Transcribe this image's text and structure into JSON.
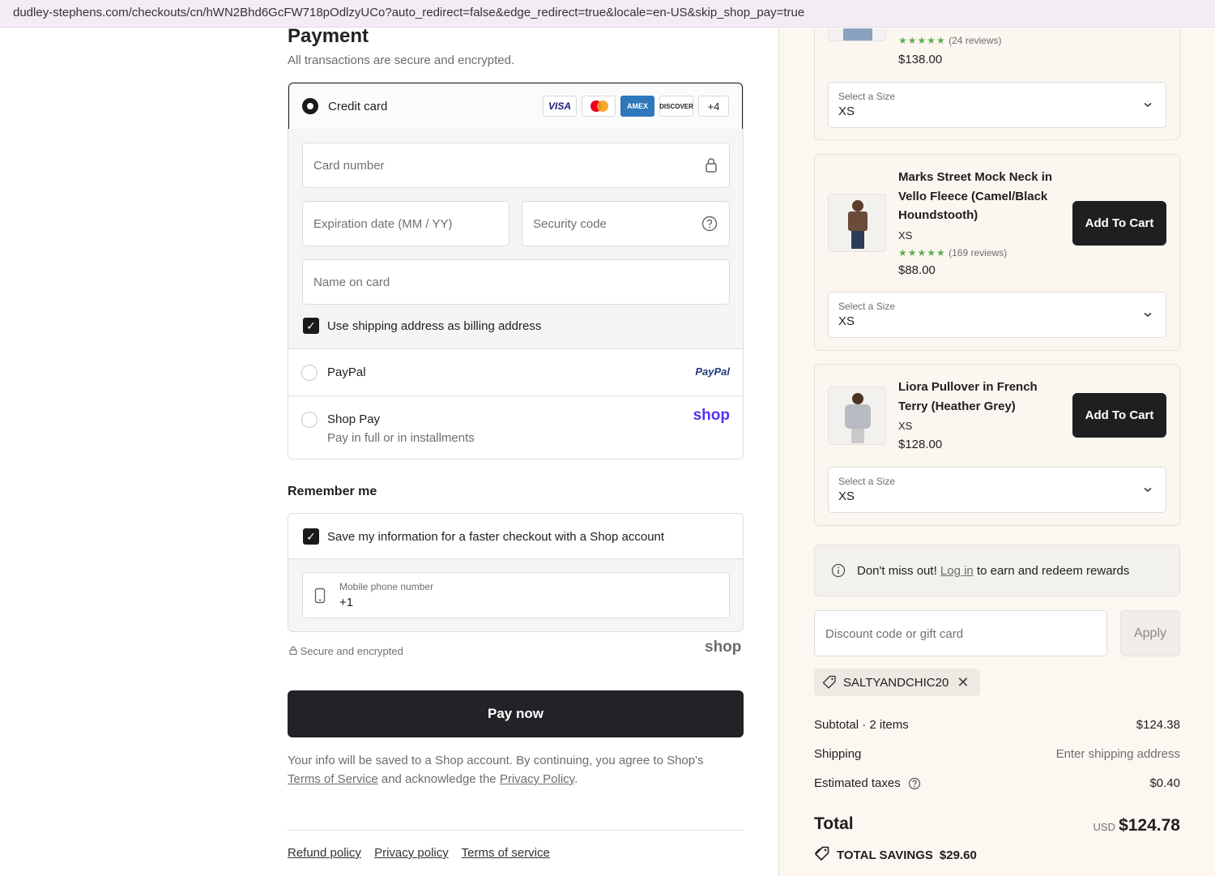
{
  "browser": {
    "url": "dudley-stephens.com/checkouts/cn/hWN2Bhd6GcFW718pOdlzyUCo?auto_redirect=false&edge_redirect=true&locale=en-US&skip_shop_pay=true"
  },
  "payment": {
    "title": "Payment",
    "subtitle": "All transactions are secure and encrypted.",
    "credit_card_label": "Credit card",
    "card_logos": [
      "VISA",
      "mastercard",
      "AMEX",
      "DISCOVER"
    ],
    "more_cards": "+4",
    "card_number_placeholder": "Card number",
    "expiration_placeholder": "Expiration date (MM / YY)",
    "security_code_placeholder": "Security code",
    "name_on_card_placeholder": "Name on card",
    "billing_checkbox_label": "Use shipping address as billing address",
    "paypal_label": "PayPal",
    "paypal_logo": "PayPal",
    "shoppay_label": "Shop Pay",
    "shoppay_sub": "Pay in full or in installments",
    "shoppay_logo": "shop"
  },
  "remember": {
    "title": "Remember me",
    "save_label": "Save my information for a faster checkout with a Shop account",
    "phone_label": "Mobile phone number",
    "phone_value": "+1",
    "secure_text": "Secure and encrypted",
    "shop_logo": "shop"
  },
  "actions": {
    "pay_now": "Pay now",
    "legal_prefix": "Your info will be saved to a Shop account. By continuing, you agree to Shop's",
    "legal_terms": "Terms of Service",
    "legal_mid": " and acknowledge the ",
    "legal_privacy": "Privacy Policy",
    "legal_end": "."
  },
  "footer": {
    "links": [
      "Refund policy",
      "Privacy policy",
      "Terms of service"
    ]
  },
  "upsell": {
    "items": [
      {
        "name": "",
        "rating": "★★★★★",
        "reviews": "(24 reviews)",
        "price": "$138.00",
        "size_label": "Select a Size",
        "size_value": "XS"
      },
      {
        "name": "Marks Street Mock Neck in Vello Fleece (Camel/Black Houndstooth)",
        "variant": "XS",
        "rating": "★★★★★",
        "reviews": "(169 reviews)",
        "price": "$88.00",
        "add_label": "Add To Cart",
        "size_label": "Select a Size",
        "size_value": "XS"
      },
      {
        "name": "Liora Pullover in French Terry (Heather Grey)",
        "variant": "XS",
        "price": "$128.00",
        "add_label": "Add To Cart",
        "size_label": "Select a Size",
        "size_value": "XS"
      }
    ]
  },
  "rewards": {
    "prefix": "Don't miss out! ",
    "link": "Log in",
    "suffix": " to earn and redeem rewards"
  },
  "discount": {
    "placeholder": "Discount code or gift card",
    "apply": "Apply",
    "applied_code": "SALTYANDCHIC20"
  },
  "summary": {
    "subtotal_label": "Subtotal · 2 items",
    "subtotal_value": "$124.38",
    "shipping_label": "Shipping",
    "shipping_value": "Enter shipping address",
    "taxes_label": "Estimated taxes",
    "taxes_value": "$0.40",
    "total_label": "Total",
    "currency": "USD",
    "total_value": "$124.78",
    "savings_label": "TOTAL SAVINGS",
    "savings_value": "$29.60"
  }
}
